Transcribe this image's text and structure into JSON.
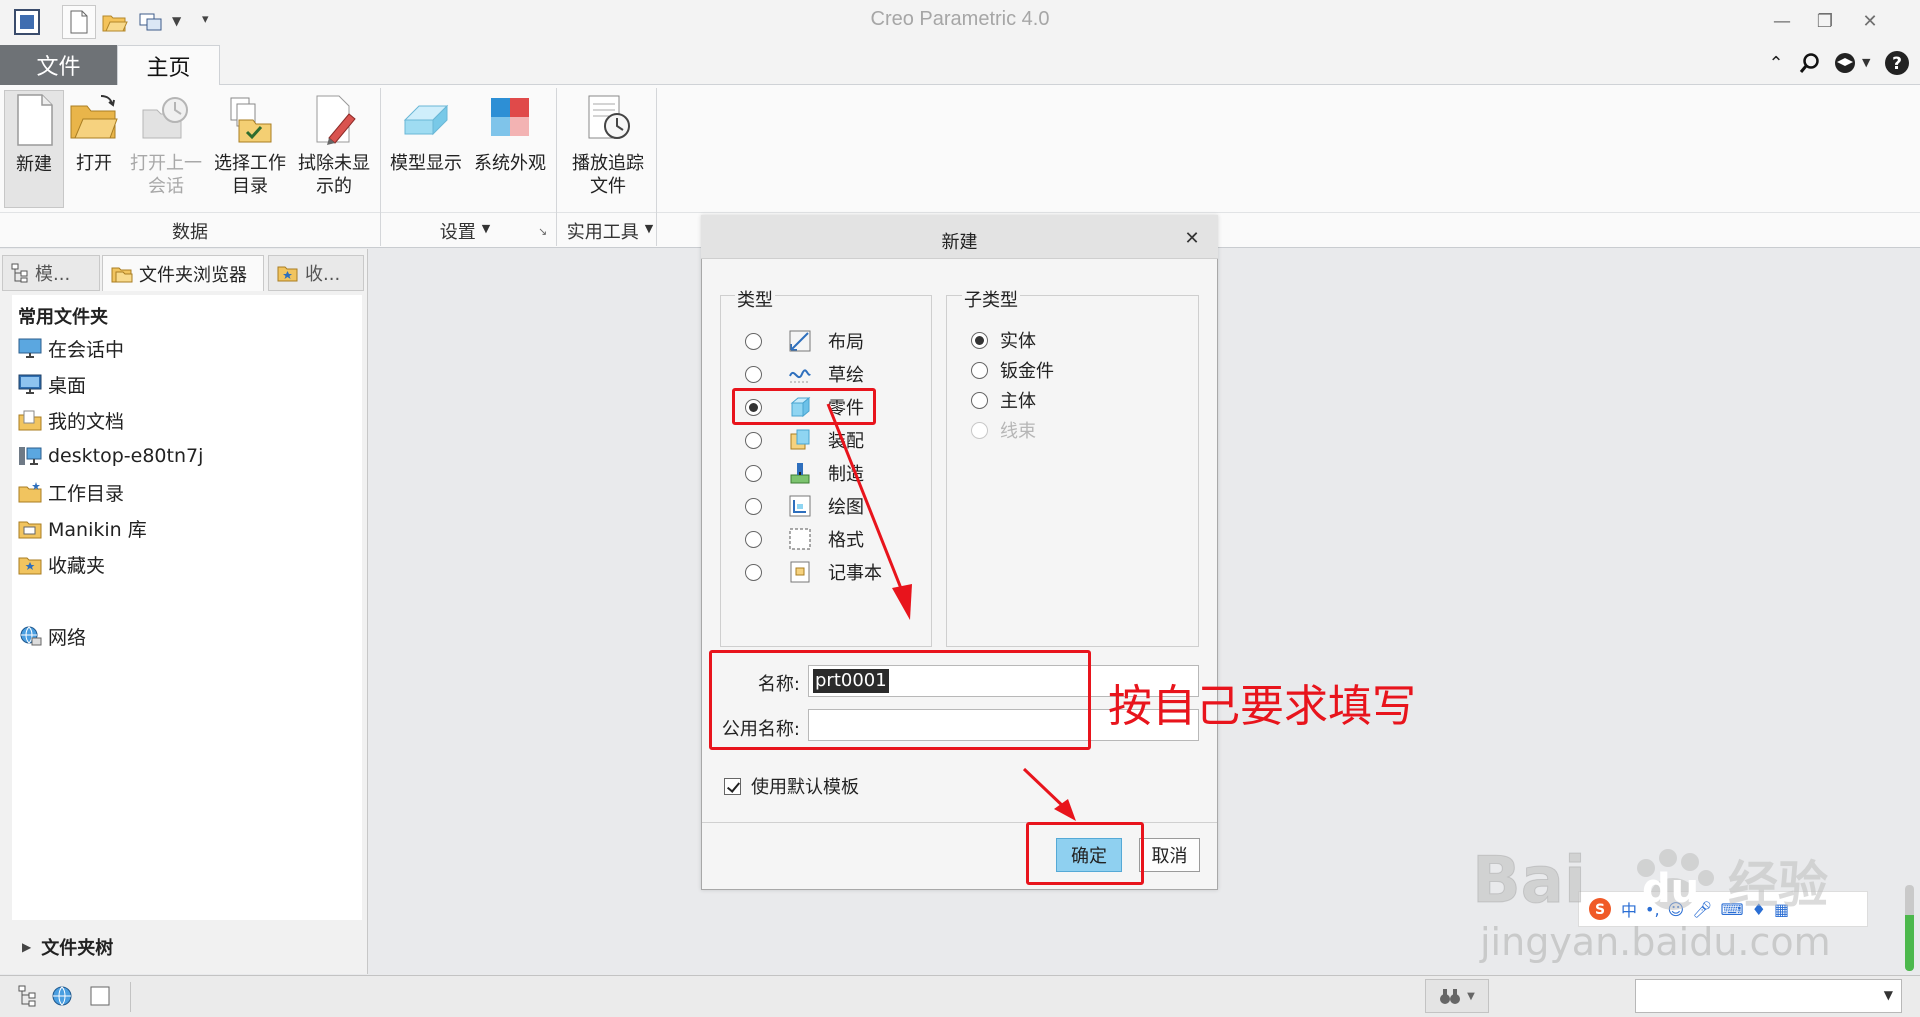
{
  "window": {
    "title": "Creo Parametric 4.0"
  },
  "ribbon_tabs": {
    "file": "文件",
    "home": "主页"
  },
  "ribbon": {
    "new": "新建",
    "open": "打开",
    "open_last_l1": "打开上一",
    "open_last_l2": "会话",
    "select_dir_l1": "选择工作",
    "select_dir_l2": "目录",
    "erase_l1": "拭除未显",
    "erase_l2": "示的",
    "model_display": "模型显示",
    "system_appearance": "系统外观",
    "playback_l1": "播放追踪",
    "playback_l2": "文件",
    "group_data": "数据",
    "group_settings": "设置",
    "group_utilities": "实用工具"
  },
  "left_panel": {
    "tabs": [
      "模...",
      "文件夹浏览器",
      "收..."
    ],
    "favorites_heading": "常用文件夹",
    "folders": [
      "在会话中",
      "桌面",
      "我的文档",
      "desktop-e80tn7j",
      "工作目录",
      "Manikin 库",
      "收藏夹"
    ],
    "network": "网络",
    "folder_tree": "文件夹树"
  },
  "dialog": {
    "title": "新建",
    "type_legend": "类型",
    "subtype_legend": "子类型",
    "types": [
      {
        "label": "布局",
        "selected": false
      },
      {
        "label": "草绘",
        "selected": false
      },
      {
        "label": "零件",
        "selected": true
      },
      {
        "label": "装配",
        "selected": false
      },
      {
        "label": "制造",
        "selected": false
      },
      {
        "label": "绘图",
        "selected": false
      },
      {
        "label": "格式",
        "selected": false
      },
      {
        "label": "记事本",
        "selected": false
      }
    ],
    "subtypes": [
      {
        "label": "实体",
        "selected": true,
        "enabled": true
      },
      {
        "label": "钣金件",
        "selected": false,
        "enabled": true
      },
      {
        "label": "主体",
        "selected": false,
        "enabled": true
      },
      {
        "label": "线束",
        "selected": false,
        "enabled": false
      }
    ],
    "name_label": "名称:",
    "name_value": "prt0001",
    "common_name_label": "公用名称:",
    "common_name_value": "",
    "use_default_template": "使用默认模板",
    "ok": "确定",
    "cancel": "取消"
  },
  "annotation": {
    "text": "按自己要求填写"
  },
  "watermark": {
    "brand": "Bai",
    "brand2": "du",
    "brand_cn": "经验",
    "url": "jingyan.baidu.com"
  },
  "colors": {
    "accent_red": "#e8141c",
    "ok_blue": "#8fd0f0",
    "file_tab": "#6e7276"
  }
}
